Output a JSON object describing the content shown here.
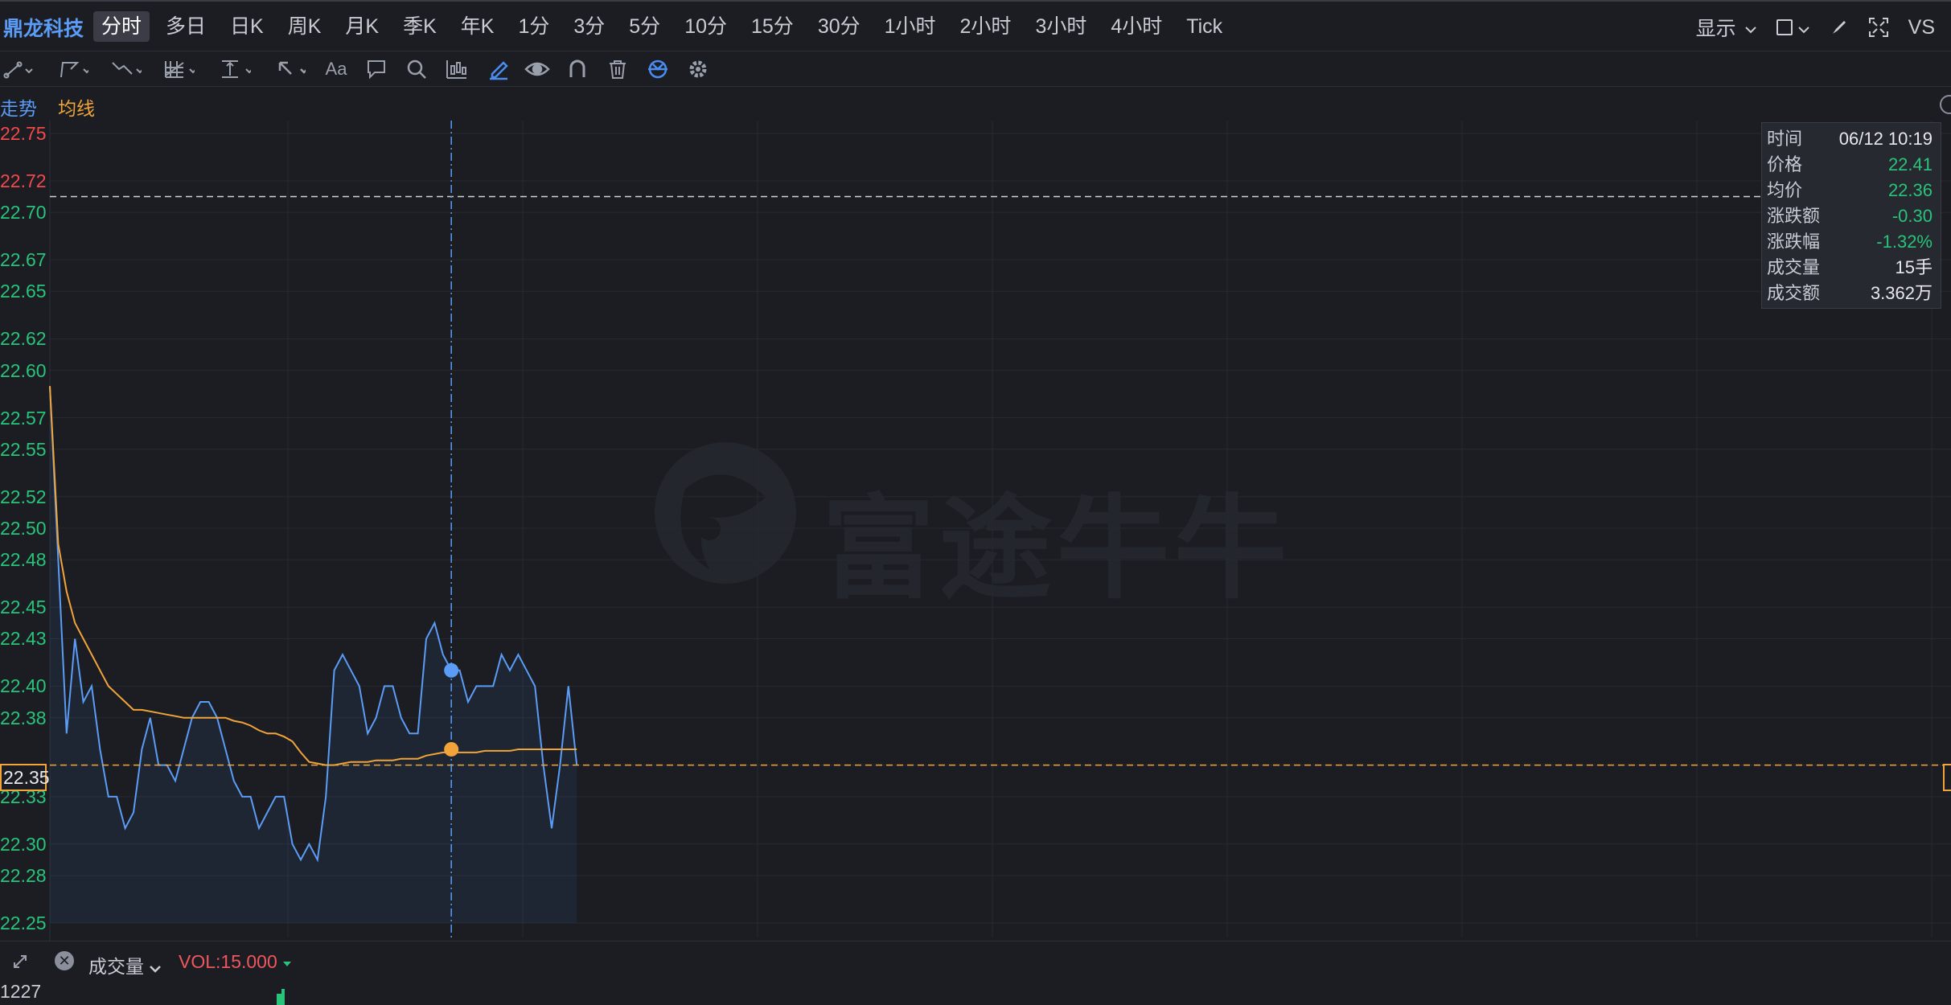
{
  "header": {
    "stock_name": "鼎龙科技",
    "periods": [
      "分时",
      "多日",
      "日K",
      "周K",
      "月K",
      "季K",
      "年K",
      "1分",
      "3分",
      "5分",
      "10分",
      "15分",
      "30分",
      "1小时",
      "2小时",
      "3小时",
      "4小时",
      "Tick"
    ],
    "active_period": "分时",
    "display_label": "显示",
    "vs_label": "VS"
  },
  "drawing_tools": {
    "text_tool": "Aa",
    "icons": [
      "line-tool-icon",
      "polyline-tool-icon",
      "wave-tool-icon",
      "grid-tool-icon",
      "fib-tool-icon",
      "arrow-tool-icon",
      "text-tool-icon",
      "comment-icon",
      "search-icon",
      "chart-tool-icon",
      "pen-icon",
      "eye-icon",
      "magnet-icon",
      "trash-icon",
      "sync-icon",
      "gear-icon"
    ]
  },
  "legend": {
    "trend": "走势",
    "ma": "均线"
  },
  "y_axis": {
    "labels": [
      "22.75",
      "22.72",
      "22.70",
      "22.67",
      "22.65",
      "22.62",
      "22.60",
      "22.57",
      "22.55",
      "22.52",
      "22.50",
      "22.48",
      "22.45",
      "22.43",
      "22.40",
      "22.38",
      "22.35",
      "22.33",
      "22.30",
      "22.28",
      "22.25"
    ],
    "current_price": "22.35"
  },
  "info_box": {
    "rows": [
      {
        "key": "时间",
        "value": "06/12 10:19"
      },
      {
        "key": "价格",
        "value": "22.41"
      },
      {
        "key": "均价",
        "value": "22.36"
      },
      {
        "key": "涨跌额",
        "value": "-0.30"
      },
      {
        "key": "涨跌幅",
        "value": "-1.32%"
      },
      {
        "key": "成交量",
        "value": "15手"
      },
      {
        "key": "成交额",
        "value": "3.362万"
      }
    ]
  },
  "watermark": "富途牛牛",
  "volume": {
    "name": "成交量",
    "value": "VOL:15.000",
    "scale_label": "1227"
  },
  "colors": {
    "price_line": "#5b9cf6",
    "avg_line": "#f0a43a",
    "up": "#f04a4a",
    "down": "#29c37a"
  },
  "chart_data": {
    "type": "line",
    "ylim": [
      22.25,
      22.75
    ],
    "series": [
      {
        "values": [
          22.59,
          22.48,
          22.37,
          22.43,
          22.39,
          22.4,
          22.36,
          22.33,
          22.33,
          22.31,
          22.32,
          22.36,
          22.38,
          22.35,
          22.35,
          22.34,
          22.36,
          22.38,
          22.39,
          22.39,
          22.38,
          22.36,
          22.34,
          22.33,
          22.33,
          22.31,
          22.32,
          22.33,
          22.33,
          22.3,
          22.29,
          22.3,
          22.29,
          22.33,
          22.41,
          22.42,
          22.41,
          22.4,
          22.37,
          22.38,
          22.4,
          22.4,
          22.38,
          22.37,
          22.37,
          22.43,
          22.44,
          22.42,
          22.41,
          22.41,
          22.39,
          22.4,
          22.4,
          22.4,
          22.42,
          22.41,
          22.42,
          22.41,
          22.4,
          22.35,
          22.31,
          22.35,
          22.4,
          22.35
        ]
      },
      {
        "values": [
          22.59,
          22.49,
          22.46,
          22.44,
          22.43,
          22.42,
          22.41,
          22.4,
          22.395,
          22.39,
          22.385,
          22.385,
          22.384,
          22.383,
          22.382,
          22.381,
          22.38,
          22.38,
          22.38,
          22.38,
          22.38,
          22.38,
          22.378,
          22.377,
          22.375,
          22.372,
          22.37,
          22.37,
          22.368,
          22.365,
          22.358,
          22.352,
          22.351,
          22.35,
          22.35,
          22.351,
          22.352,
          22.352,
          22.352,
          22.353,
          22.353,
          22.353,
          22.354,
          22.354,
          22.354,
          22.356,
          22.357,
          22.358,
          22.358,
          22.358,
          22.358,
          22.358,
          22.359,
          22.359,
          22.359,
          22.359,
          22.36,
          22.36,
          22.36,
          22.36,
          22.36,
          22.36,
          22.36,
          22.36
        ]
      }
    ],
    "crosshair_index": 48,
    "crosshair_price": 22.41,
    "crosshair_avg": 22.36
  }
}
